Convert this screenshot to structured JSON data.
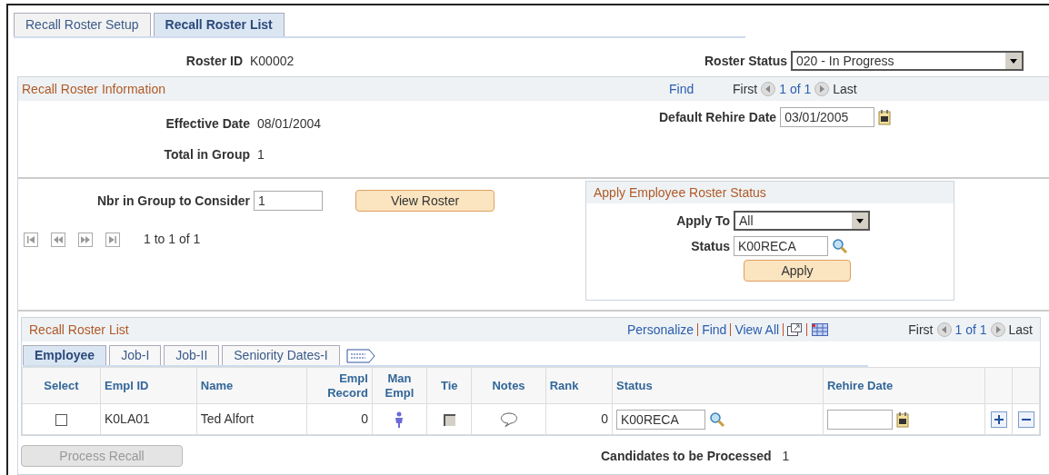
{
  "tabs": [
    {
      "label": "Recall Roster Setup",
      "selected": false
    },
    {
      "label": "Recall Roster List",
      "selected": true
    }
  ],
  "roster_id": {
    "label": "Roster ID",
    "value": "K00002"
  },
  "roster_status": {
    "label": "Roster Status",
    "value": "020 - In Progress"
  },
  "info": {
    "title": "Recall Roster Information",
    "find": "Find",
    "first": "First",
    "count": "1 of 1",
    "last": "Last",
    "effective_date": {
      "label": "Effective Date",
      "value": "08/01/2004"
    },
    "total_in_group": {
      "label": "Total in Group",
      "value": "1"
    },
    "default_rehire_date": {
      "label": "Default Rehire Date",
      "value": "03/01/2005"
    }
  },
  "consider": {
    "label": "Nbr in Group to Consider",
    "value": "1",
    "button": "View Roster",
    "range": "1 to 1 of 1"
  },
  "apply_panel": {
    "title": "Apply Employee Roster Status",
    "apply_to": {
      "label": "Apply To",
      "value": "All"
    },
    "status": {
      "label": "Status",
      "value": "K00RECA"
    },
    "button": "Apply"
  },
  "grid": {
    "title": "Recall Roster List",
    "links": [
      "Personalize",
      "Find",
      "View All"
    ],
    "first": "First",
    "count": "1 of 1",
    "last": "Last",
    "tabs": [
      {
        "label": "Employee",
        "selected": true
      },
      {
        "label": "Job-I",
        "selected": false
      },
      {
        "label": "Job-II",
        "selected": false
      },
      {
        "label": "Seniority Dates-I",
        "selected": false
      }
    ],
    "columns": [
      "Select",
      "Empl ID",
      "Name",
      "Empl Record",
      "Man Empl",
      "Tie",
      "Notes",
      "Rank",
      "Status",
      "Rehire Date"
    ],
    "rows": [
      {
        "checked": false,
        "empl_id": "K0LA01",
        "name": "Ted Alfort",
        "empl_record": "0",
        "tie": {
          "checked": false,
          "disabled": true
        },
        "rank": "0",
        "status": "K00RECA"
      }
    ]
  },
  "process_button": {
    "label": "Process Recall",
    "disabled": true
  },
  "candidates": {
    "label": "Candidates to be Processed",
    "value": "1"
  }
}
